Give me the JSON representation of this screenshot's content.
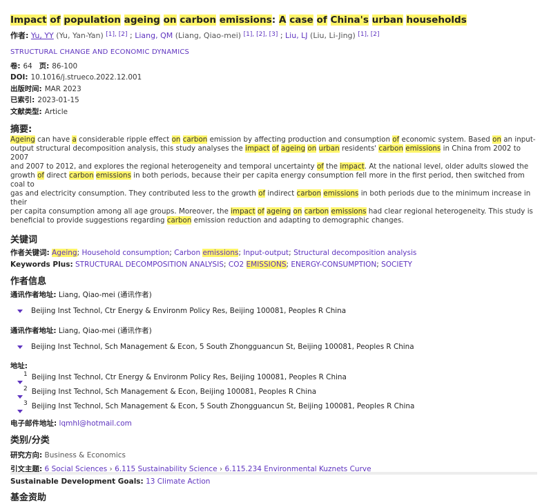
{
  "title": [
    "Impact",
    " ",
    "of",
    " ",
    "population",
    " ",
    "ageing",
    " ",
    "on",
    " ",
    "carbon",
    " ",
    "emissions",
    ": ",
    "A",
    " ",
    "case",
    " ",
    "of",
    " ",
    "China's",
    " ",
    "urban",
    " ",
    "households"
  ],
  "authors_label": "作者:",
  "authors": [
    {
      "short": "Yu, YY",
      "full": "(Yu, Yan-Yan)",
      "refs": [
        "[1]",
        ", ",
        "[2]"
      ]
    },
    {
      "short": "Liang, QM",
      "full": "(Liang, Qiao-mei)",
      "refs": [
        "[1]",
        ", ",
        "[2]",
        ", ",
        "[3]"
      ]
    },
    {
      "short": "Liu, LJ",
      "full": "(Liu, Li-Jing)",
      "refs": [
        "[1]",
        ", ",
        "[2]"
      ]
    }
  ],
  "journal": "STRUCTURAL CHANGE AND ECONOMIC DYNAMICS",
  "meta": {
    "volume_label": "卷:",
    "volume": "64",
    "pages_label": "页:",
    "pages": "86-100",
    "doi_label": "DOI:",
    "doi": "10.1016/j.strueco.2022.12.001",
    "published_label": "出版时间:",
    "published": "MAR 2023",
    "indexed_label": "已索引:",
    "indexed": "2023-01-15",
    "doctype_label": "文献类型:",
    "doctype": "Article"
  },
  "abstract_heading": "摘要:",
  "abstract_lines": [
    "Ageing can have a considerable ripple effect on carbon emission by affecting production and consumption of economic system. Based on an input-",
    "output structural decomposition analysis, this study analyses the impact of ageing on urban residents' carbon emissions in China from 2002 to 2007",
    "and 2007 to 2012, and explores the regional heterogeneity and temporal uncertainty of the impact. At the national level, older adults slowed the",
    "growth of direct carbon emissions in both periods, because their per capita energy consumption fell more in the first period, then switched from coal to",
    "gas and electricity consumption. They contributed less to the growth of indirect carbon emissions in both periods due to the minimum increase in their",
    "per capita consumption among all age groups. Moreover, the impact of ageing on carbon emissions had clear regional heterogeneity. This study is",
    "beneficial to provide suggestions regarding carbon emission reduction and adapting to demographic changes."
  ],
  "keywords_heading": "关键词",
  "author_keywords_label": "作者关键词:",
  "author_keywords": [
    "Ageing",
    "Household consumption",
    "Carbon emissions",
    "Input-output",
    "Structural decomposition analysis"
  ],
  "keywords_plus_label": "Keywords Plus:",
  "keywords_plus": [
    "STRUCTURAL DECOMPOSITION ANALYSIS",
    "CO2 EMISSIONS",
    "ENERGY-CONSUMPTION",
    "SOCIETY"
  ],
  "author_info_heading": "作者信息",
  "corr_label": "通讯作者地址:",
  "corr_author": "Liang, Qiao-mei (通讯作者)",
  "corr_addr_1": "Beijing Inst Technol, Ctr Energy & Environm Policy Res, Beijing 100081, Peoples R China",
  "corr_addr_2": "Beijing Inst Technol, Sch Management & Econ, 5 South Zhongguancun St, Beijing 100081, Peoples R China",
  "address_label": "地址:",
  "addresses": [
    {
      "n": "1",
      "text": "Beijing Inst Technol, Ctr Energy & Environm Policy Res, Beijing 100081, Peoples R China"
    },
    {
      "n": "2",
      "text": "Beijing Inst Technol, Sch Management & Econ, Beijing 100081, Peoples R China"
    },
    {
      "n": "3",
      "text": "Beijing Inst Technol, Sch Management & Econ, 5 South Zhongguancun St, Beijing 100081, Peoples R China"
    }
  ],
  "email_label": "电子邮件地址:",
  "email": "lqmhl@hotmail.com",
  "category_heading": "类别/分类",
  "research_area_label": "研究方向:",
  "research_area": "Business & Economics",
  "citation_topic_label": "引文主题:",
  "citation_topics": [
    "6 Social Sciences",
    "6.115 Sustainability Science",
    "6.115.234 Environmental Kuznets Curve"
  ],
  "sdg_label": "Sustainable Development Goals:",
  "sdg": "13 Climate Action",
  "funding_heading": "基金资助",
  "highlight_terms": [
    "Ageing",
    "ageing",
    "a",
    "on",
    "carbon",
    "of",
    "impact",
    "urban",
    "emissions",
    "EMISSIONS"
  ],
  "colors": {
    "highlight": "#fff56a",
    "link": "#5e33bf"
  }
}
